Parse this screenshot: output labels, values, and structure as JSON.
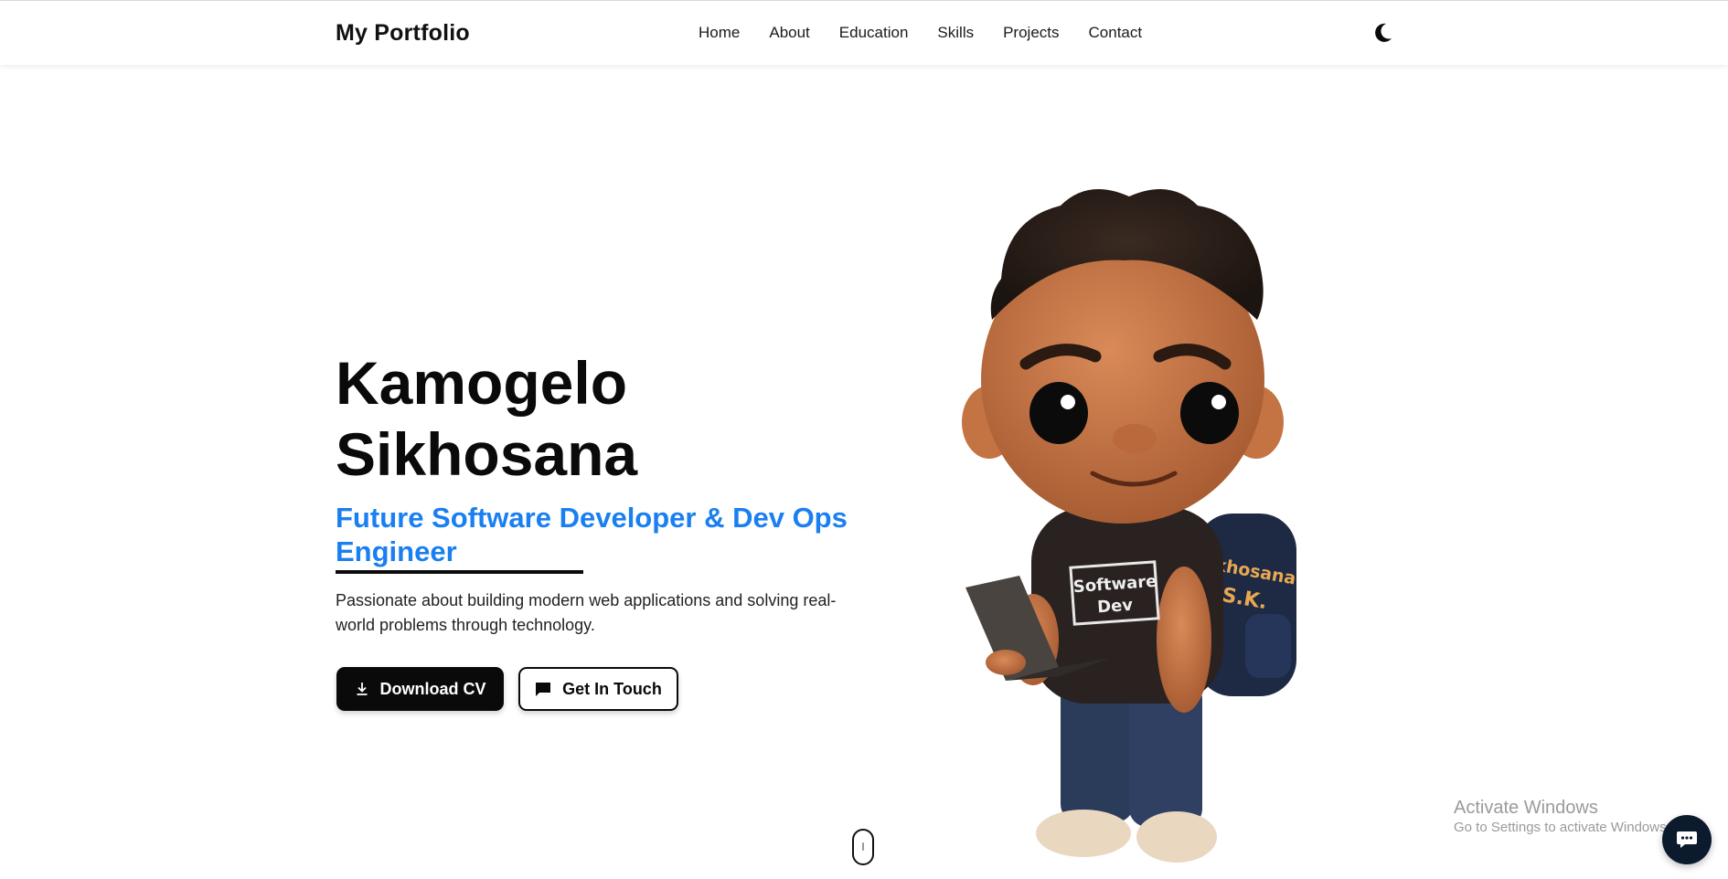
{
  "navbar": {
    "brand": "My Portfolio",
    "links": [
      "Home",
      "About",
      "Education",
      "Skills",
      "Projects",
      "Contact"
    ],
    "theme_toggle_icon": "moon-icon"
  },
  "hero": {
    "name_line1": "Kamogelo",
    "name_line2": "Sikhosana",
    "role": "Future Software Developer & Dev Ops Engineer",
    "description": "Passionate about building modern web applications and solving real-world problems through technology.",
    "download_cv_label": "Download CV",
    "get_in_touch_label": "Get In Touch",
    "download_icon": "download-icon",
    "message_icon": "message-icon"
  },
  "avatar": {
    "shirt_text_line1": "Software",
    "shirt_text_line2": "Dev",
    "backpack_text_line1": "Sikhosana",
    "backpack_text_line2": "S.K."
  },
  "os_watermark": {
    "title": "Activate Windows",
    "subtitle": "Go to Settings to activate Windows."
  },
  "chat": {
    "icon": "chat-icon"
  },
  "colors": {
    "accent": "#1a7ff0",
    "primary": "#0a0a0a",
    "background": "#ffffff"
  }
}
